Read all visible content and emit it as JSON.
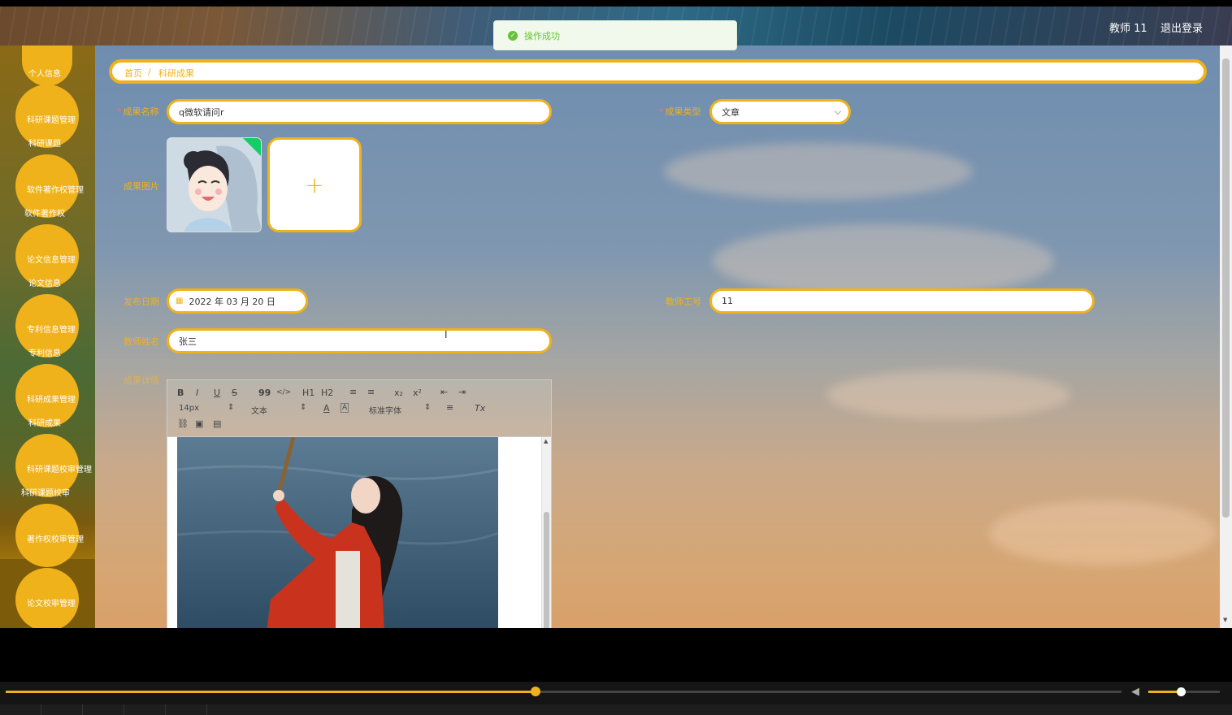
{
  "header": {
    "user_label": "教师 11",
    "logout_label": "退出登录"
  },
  "toast": {
    "message": "操作成功"
  },
  "sidebar": {
    "top_item": "个人信息",
    "groups": [
      {
        "title": "科研课题管理",
        "sub": "科研课题"
      },
      {
        "title": "软件著作权管理",
        "sub": "软件著作权"
      },
      {
        "title": "论文信息管理",
        "sub": "论文信息"
      },
      {
        "title": "专利信息管理",
        "sub": "专利信息"
      },
      {
        "title": "科研成果管理",
        "sub": "科研成果"
      },
      {
        "title": "科研课题校审管理",
        "sub": "科研课题校审"
      },
      {
        "title": "著作权校审管理",
        "sub": ""
      },
      {
        "title": "论文校审管理",
        "sub": ""
      }
    ]
  },
  "breadcrumb": {
    "home": "首页",
    "separator": "/",
    "current": "科研成果"
  },
  "form": {
    "name_label": "成果名称",
    "name_value": "q微软请问r",
    "type_label": "成果类型",
    "type_value": "文章",
    "image_label": "成果图片",
    "upload_plus": "+",
    "date_label": "发布日期",
    "date_value": "2022 年 03 月 20 日",
    "teacher_no_label": "教师工号",
    "teacher_no_value": "11",
    "teacher_name_label": "教师姓名",
    "teacher_name_value": "张三",
    "detail_label": "成果详情"
  },
  "editor": {
    "bold": "B",
    "italic": "I",
    "underline": "U",
    "strike": "S",
    "quote": "99",
    "code": "</>",
    "h1": "H1",
    "h2": "H2",
    "ol": "≡",
    "ul": "≡",
    "sub": "x₂",
    "sup": "x²",
    "outdent": "⇤",
    "indent": "⇥",
    "size": "14px",
    "type": "文本",
    "font_color": "A",
    "bg_color": "A",
    "font_family": "标准字体",
    "align": "≡",
    "clean": "Tx",
    "link": "⛓",
    "image": "▣",
    "video": "▤"
  },
  "colors": {
    "accent": "#f0b21a",
    "success": "#67c23a",
    "required": "#f56c6c"
  }
}
